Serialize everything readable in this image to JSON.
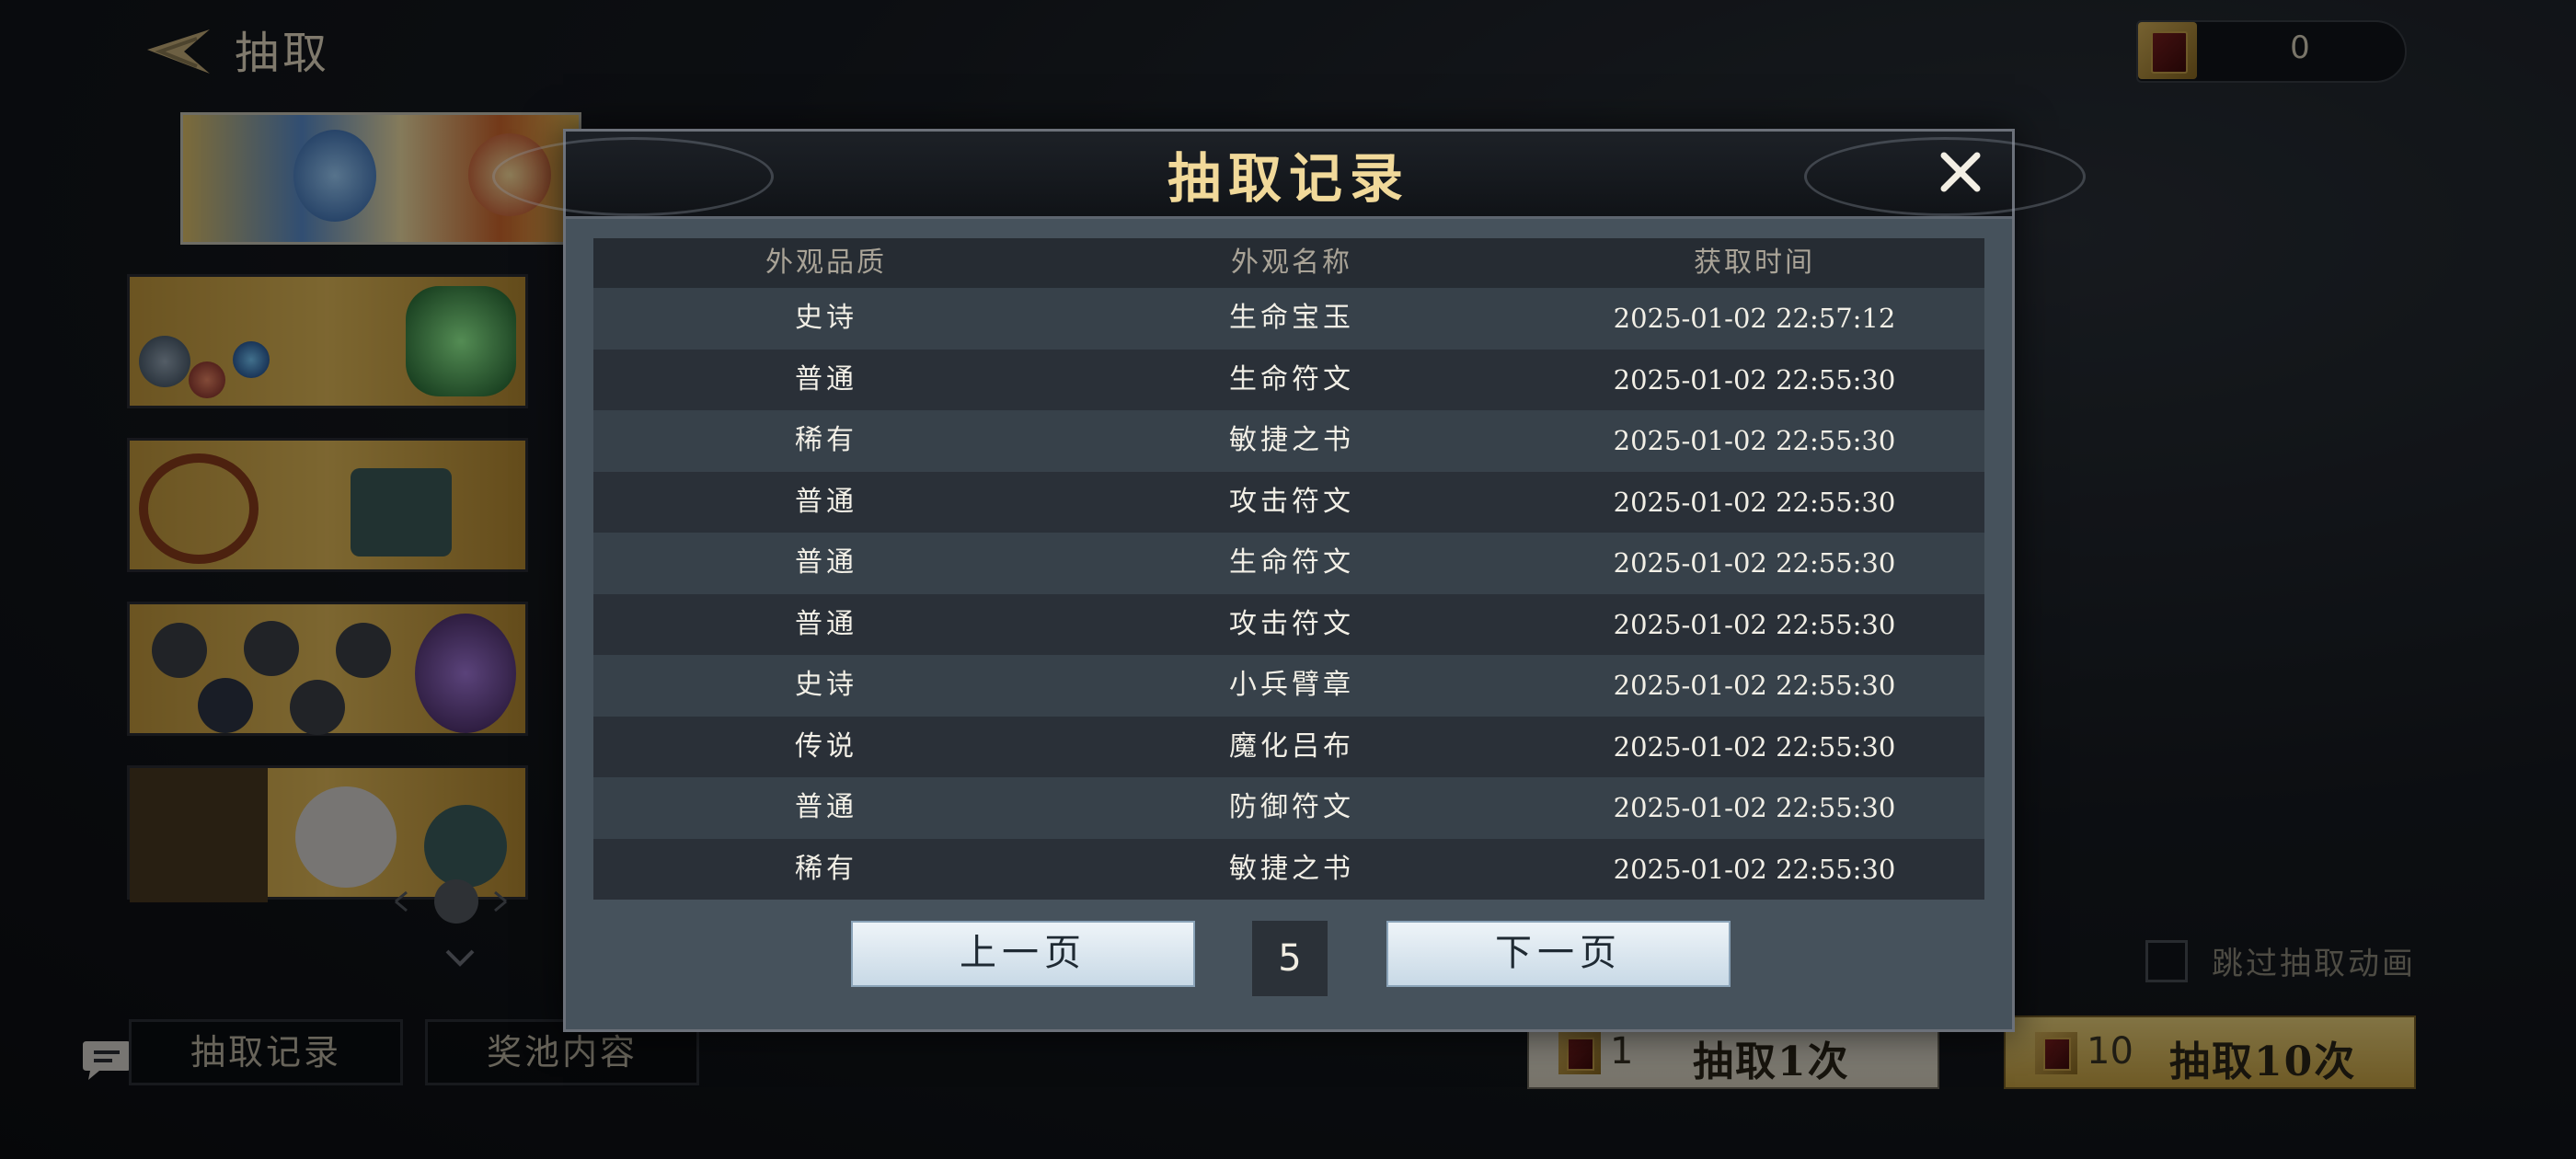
{
  "header": {
    "title": "抽取",
    "currency_value": "0"
  },
  "sidebar": {
    "banners": [
      "banner-top",
      "banner-2",
      "banner-3",
      "banner-4",
      "banner-5"
    ]
  },
  "bottom": {
    "tab_record": "抽取记录",
    "tab_pool": "奖池内容",
    "skip_label": "跳过抽取动画",
    "draw1": {
      "count": "1",
      "label": "抽取1次"
    },
    "draw10": {
      "count": "10",
      "label": "抽取10次"
    }
  },
  "modal": {
    "title": "抽取记录",
    "columns": [
      "外观品质",
      "外观名称",
      "获取时间"
    ],
    "rows": [
      [
        "史诗",
        "生命宝玉",
        "2025-01-02 22:57:12"
      ],
      [
        "普通",
        "生命符文",
        "2025-01-02 22:55:30"
      ],
      [
        "稀有",
        "敏捷之书",
        "2025-01-02 22:55:30"
      ],
      [
        "普通",
        "攻击符文",
        "2025-01-02 22:55:30"
      ],
      [
        "普通",
        "生命符文",
        "2025-01-02 22:55:30"
      ],
      [
        "普通",
        "攻击符文",
        "2025-01-02 22:55:30"
      ],
      [
        "史诗",
        "小兵臂章",
        "2025-01-02 22:55:30"
      ],
      [
        "传说",
        "魔化吕布",
        "2025-01-02 22:55:30"
      ],
      [
        "普通",
        "防御符文",
        "2025-01-02 22:55:30"
      ],
      [
        "稀有",
        "敏捷之书",
        "2025-01-02 22:55:30"
      ]
    ],
    "prev_label": "上一页",
    "next_label": "下一页",
    "page": "5"
  },
  "colors": {
    "title_gold": "#f1d99a",
    "draw10_gold": "#e0c062",
    "modal_bg": "#46525c"
  },
  "icons": [
    "back-arrow-icon",
    "spellbook-icon",
    "close-icon",
    "chat-bubble-icon",
    "chevron-down-icon",
    "checkbox"
  ]
}
